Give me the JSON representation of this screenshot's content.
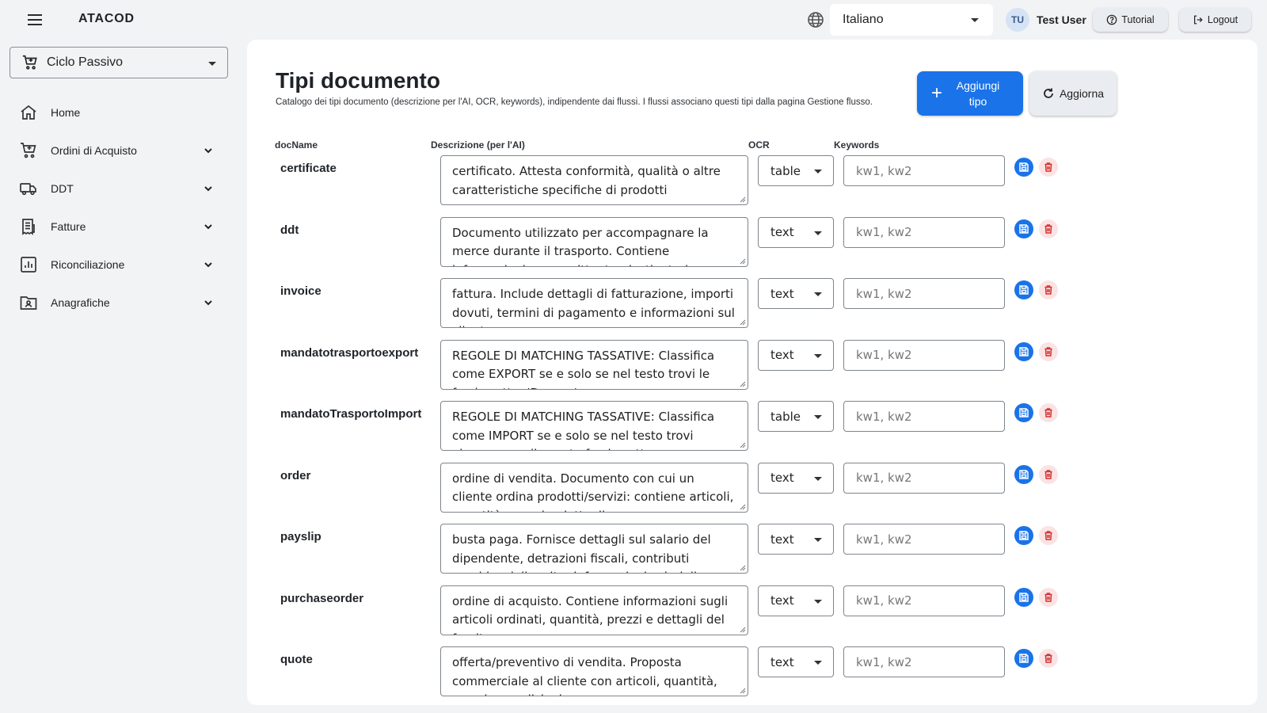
{
  "app": {
    "brand": "ATACOD"
  },
  "header": {
    "language": "Italiano",
    "user_initials": "TU",
    "user_name": "Test User",
    "tutorial_label": "Tutorial",
    "logout_label": "Logout"
  },
  "sidebar": {
    "module": "Ciclo Passivo",
    "items": [
      {
        "label": "Home",
        "icon": "home-icon",
        "expandable": false
      },
      {
        "label": "Ordini di Acquisto",
        "icon": "cart-icon",
        "expandable": true
      },
      {
        "label": "DDT",
        "icon": "truck-icon",
        "expandable": true
      },
      {
        "label": "Fatture",
        "icon": "receipt-icon",
        "expandable": true
      },
      {
        "label": "Riconciliazione",
        "icon": "chart-icon",
        "expandable": true
      },
      {
        "label": "Anagrafiche",
        "icon": "folder-user-icon",
        "expandable": true
      }
    ]
  },
  "page": {
    "title": "Tipi documento",
    "subtitle": "Catalogo dei tipi documento (descrizione per l'AI, OCR, keywords), indipendente dai flussi. I flussi associano questi tipi dalla pagina Gestione flusso.",
    "add_button": "Aggiungi tipo",
    "refresh_button": "Aggiorna"
  },
  "table": {
    "columns": [
      "docName",
      "Descrizione (per l'AI)",
      "OCR",
      "Keywords"
    ],
    "keywords_placeholder": "kw1, kw2",
    "rows": [
      {
        "docName": "certificate",
        "description": "certificato. Attesta conformità, qualità o altre caratteristiche specifiche di prodotti",
        "ocr": "table"
      },
      {
        "docName": "ddt",
        "description": "Documento utilizzato per accompagnare la merce durante il trasporto. Contiene informazioni come mittente, destinatario e dettagli della merce",
        "ocr": "text"
      },
      {
        "docName": "invoice",
        "description": "fattura. Include dettagli di fatturazione, importi dovuti, termini di pagamento e informazioni sul cliente",
        "ocr": "text"
      },
      {
        "docName": "mandatotrasportoexport",
        "description": "REGOLE DI MATCHING TASSATIVE: Classifica come EXPORT se e solo se nel testo trovi le frasi esatte: 'Dear ...'",
        "ocr": "text"
      },
      {
        "docName": "mandatoTrasportoImport",
        "description": "REGOLE DI MATCHING TASSATIVE: Classifica come IMPORT se e solo se nel testo trovi almeno una di queste frasi esatte",
        "ocr": "table"
      },
      {
        "docName": "order",
        "description": "ordine di vendita. Documento con cui un cliente ordina prodotti/servizi: contiene articoli, quantità, prezzi e dettagli",
        "ocr": "text"
      },
      {
        "docName": "payslip",
        "description": "busta paga. Fornisce dettagli sul salario del dipendente, detrazioni fiscali, contributi previdenziali e altre informazioni salariali",
        "ocr": "text"
      },
      {
        "docName": "purchaseorder",
        "description": "ordine di acquisto. Contiene informazioni sugli articoli ordinati, quantità, prezzi e dettagli del fornitore",
        "ocr": "text"
      },
      {
        "docName": "quote",
        "description": "offerta/preventivo di vendita. Proposta commerciale al cliente con articoli, quantità, prezzi e condizioni,",
        "ocr": "text"
      }
    ]
  }
}
